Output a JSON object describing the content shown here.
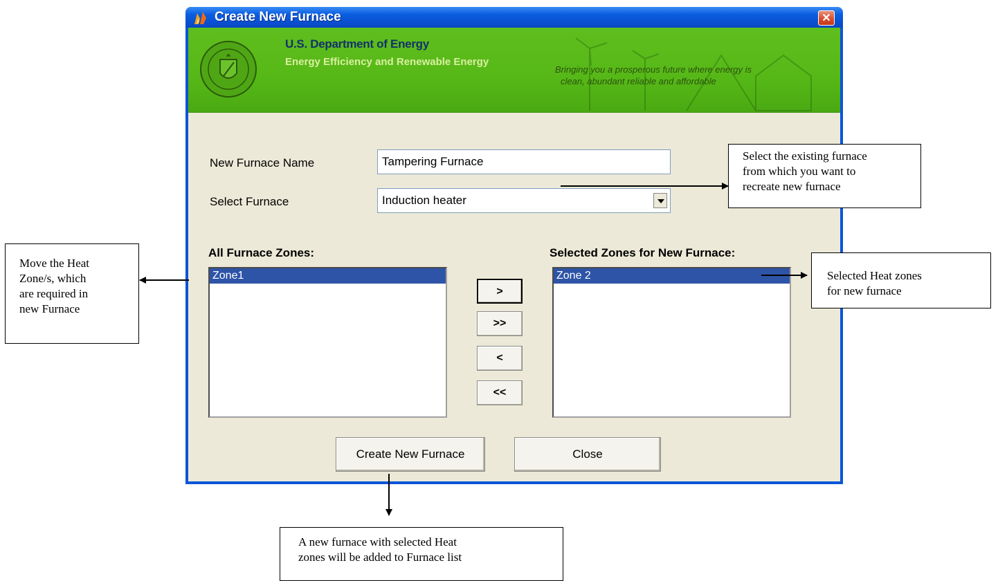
{
  "window": {
    "title": "Create New Furnace",
    "close_label": "✕"
  },
  "banner": {
    "department": "U.S. Department of Energy",
    "subtitle": "Energy Efficiency and Renewable Energy",
    "tagline_line1": "Bringing you a prosperous future where energy is",
    "tagline_line2": "clean, abundant reliable and affordable"
  },
  "form": {
    "name_label": "New Furnace Name",
    "name_value": "Tampering Furnace",
    "select_label": "Select Furnace",
    "select_value": "Induction heater"
  },
  "zones": {
    "all_label": "All Furnace Zones:",
    "selected_label": "Selected Zones for New Furnace:",
    "all_items": [
      "Zone1"
    ],
    "selected_items": [
      "Zone 2"
    ]
  },
  "move_buttons": {
    "add_one": ">",
    "add_all": ">>",
    "remove_one": "<",
    "remove_all": "<<"
  },
  "actions": {
    "create_label": "Create New Furnace",
    "close_label": "Close"
  },
  "callouts": {
    "select_furnace": {
      "line1": "Select the existing furnace",
      "line2": "from which you want to",
      "line3": "recreate new furnace"
    },
    "move_zones": {
      "line1": "Move the Heat",
      "line2": "Zone/s, which",
      "line3": "are required in",
      "line4": "new Furnace"
    },
    "selected_zones": {
      "line1": "Selected Heat zones",
      "line2": "for new furnace"
    },
    "new_furnace": {
      "line1": "A new furnace with selected Heat",
      "line2": "zones will be added to Furnace list"
    }
  },
  "colors": {
    "title_bar": "#0a55d8",
    "banner_green": "#5fbe1e",
    "selection": "#2d54a6",
    "dialog_bg": "#ece9d8"
  }
}
